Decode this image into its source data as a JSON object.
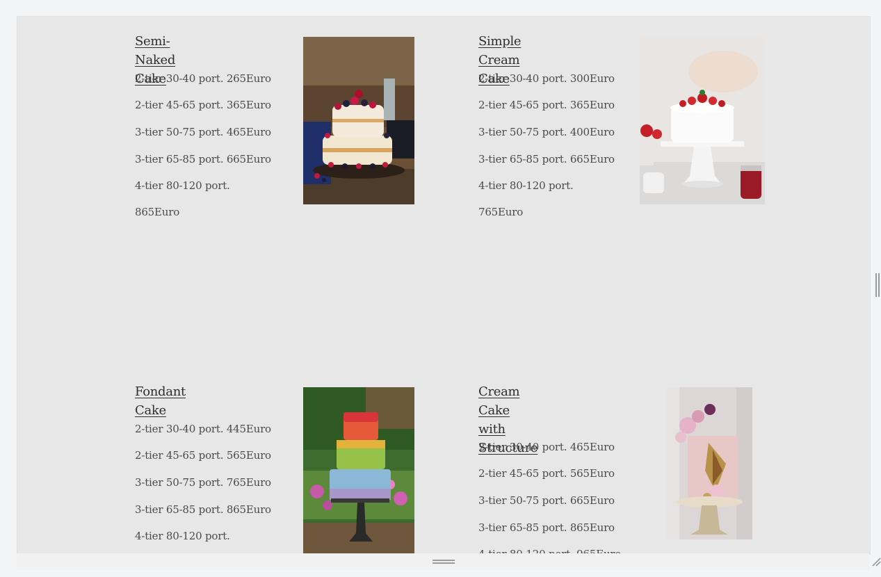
{
  "cakes": [
    {
      "name": "Semi-Naked Cake",
      "prices": [
        "2-tier 30-40 port. 265Euro",
        "2-tier 45-65 port. 365Euro",
        "3-tier 50-75 port. 465Euro",
        "3-tier 65-85 port. 665Euro",
        "4-tier 80-120 port.",
        "865Euro"
      ],
      "image": "semi-naked-cake-photo"
    },
    {
      "name": "Simple Cream Cake",
      "prices": [
        "2-tier 30-40 port. 300Euro",
        "2-tier 45-65 port. 365Euro",
        "3-tier 50-75 port. 400Euro",
        "3-tier 65-85 port. 665Euro",
        "4-tier 80-120 port.",
        "765Euro"
      ],
      "image": "simple-cream-cake-photo"
    },
    {
      "name": "Fondant Cake",
      "prices": [
        "2-tier 30-40 port. 445Euro",
        "2-tier 45-65 port. 565Euro",
        "3-tier 50-75 port. 765Euro",
        "3-tier 65-85 port. 865Euro",
        "4-tier 80-120 port."
      ],
      "image": "fondant-cake-photo"
    },
    {
      "name_line1": "Cream Cake with",
      "name_line2": "Structure",
      "prices": [
        "2-tier 30-40 port. 465Euro",
        "2-tier 45-65 port. 565Euro",
        "3-tier 50-75 port. 665Euro",
        "3-tier 65-85 port. 865Euro",
        "4-tier 80-120 port. 965Euro"
      ],
      "image": "structure-cream-cake-photo"
    }
  ],
  "colors": {
    "background": "#e8e7e7",
    "title_text": "#2e2e2e",
    "body_text": "#4a4a4a"
  }
}
